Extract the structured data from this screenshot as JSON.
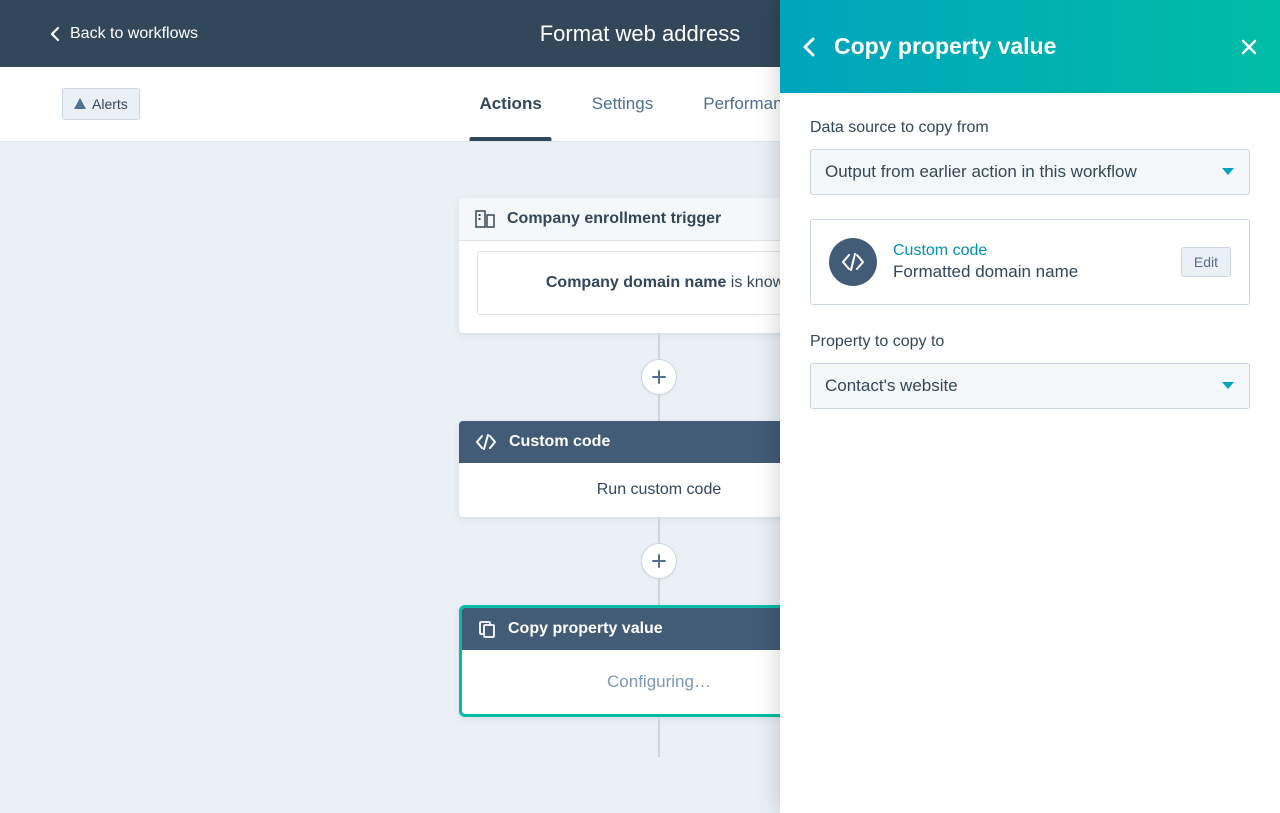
{
  "top": {
    "back": "Back to workflows",
    "title": "Format web address"
  },
  "subbar": {
    "alerts": "Alerts",
    "tabs": [
      "Actions",
      "Settings",
      "Performance"
    ]
  },
  "flow": {
    "trigger": {
      "title": "Company enrollment trigger",
      "prop": "Company domain name",
      "cond": " is know"
    },
    "custom": {
      "title": "Custom code",
      "body": "Run custom code"
    },
    "copy": {
      "title": "Copy property value",
      "body": "Configuring…"
    }
  },
  "panel": {
    "title": "Copy property value",
    "label1": "Data source to copy from",
    "select1": "Output from earlier action in this workflow",
    "source": {
      "link": "Custom code",
      "sub": "Formatted domain name",
      "edit": "Edit"
    },
    "label2": "Property to copy to",
    "select2": "Contact's website"
  }
}
